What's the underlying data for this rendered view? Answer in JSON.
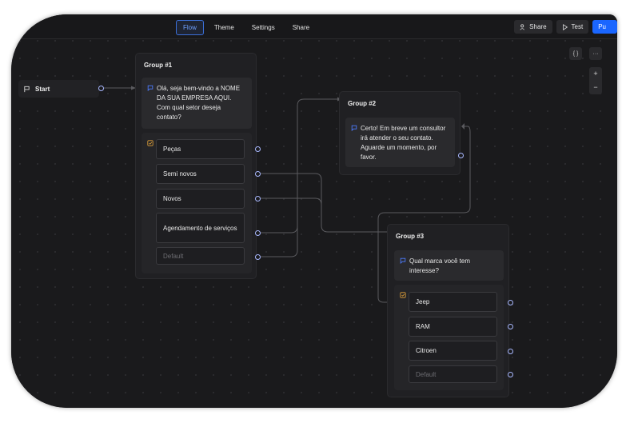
{
  "topbar": {
    "tabs": [
      {
        "label": "Flow"
      },
      {
        "label": "Theme"
      },
      {
        "label": "Settings"
      },
      {
        "label": "Share"
      }
    ],
    "share_button": "Share",
    "test_button": "Test",
    "publish_button": "Pu"
  },
  "toolbar": {
    "code_label": "{ }",
    "more_label": "···",
    "zoom_in": "+",
    "zoom_out": "−"
  },
  "start": {
    "label": "Start"
  },
  "groups": [
    {
      "title": "Group #1",
      "message": "Olá, seja bem-vindo a NOME DA SUA EMPRESA AQUI. Com qual setor deseja contato?",
      "choices": [
        "Peças",
        "Semi novos",
        "Novos",
        "Agendamento de serviços"
      ],
      "default": "Default"
    },
    {
      "title": "Group #2",
      "message": "Certo! Em breve um consultor irá atender o seu contato. Aguarde um momento, por favor."
    },
    {
      "title": "Group #3",
      "message": "Qual marca você tem interesse?",
      "choices": [
        "Jeep",
        "RAM",
        "Citroen"
      ],
      "default": "Default"
    }
  ],
  "colors": {
    "accent": "#1a66ff",
    "active_tab": "#6fa0ff",
    "port": "#a9b8ff",
    "message_icon": "#4d7cff",
    "choice_icon": "#e0a03a",
    "edge": "#5a5a5e"
  }
}
